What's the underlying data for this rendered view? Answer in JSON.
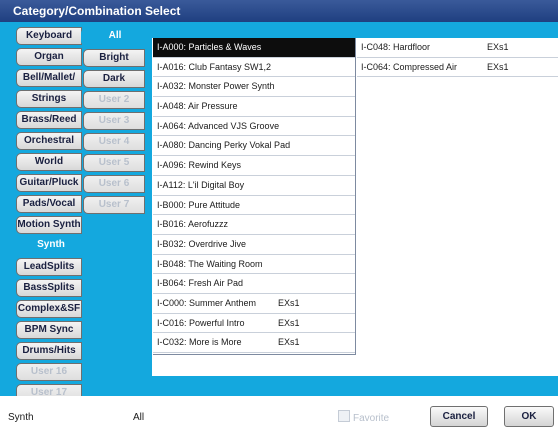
{
  "dialog": {
    "title": "Category/Combination Select"
  },
  "categories": [
    {
      "label": "Keyboard",
      "state": "normal"
    },
    {
      "label": "Organ",
      "state": "normal"
    },
    {
      "label": "Bell/Mallet/",
      "state": "normal"
    },
    {
      "label": "Strings",
      "state": "normal"
    },
    {
      "label": "Brass/Reed",
      "state": "normal"
    },
    {
      "label": "Orchestral",
      "state": "normal"
    },
    {
      "label": "World",
      "state": "normal"
    },
    {
      "label": "Guitar/Pluck",
      "state": "normal"
    },
    {
      "label": "Pads/Vocal",
      "state": "normal"
    },
    {
      "label": "Motion Synth",
      "state": "normal"
    },
    {
      "label": "Synth",
      "state": "selected"
    },
    {
      "label": "LeadSplits",
      "state": "normal"
    },
    {
      "label": "BassSplits",
      "state": "normal"
    },
    {
      "label": "Complex&SF",
      "state": "normal"
    },
    {
      "label": "BPM Sync",
      "state": "normal"
    },
    {
      "label": "Drums/Hits",
      "state": "normal"
    },
    {
      "label": "User 16",
      "state": "disabled"
    },
    {
      "label": "User 17",
      "state": "disabled"
    }
  ],
  "subcategories": [
    {
      "label": "All",
      "state": "selected"
    },
    {
      "label": "Bright",
      "state": "normal"
    },
    {
      "label": "Dark",
      "state": "normal"
    },
    {
      "label": "User 2",
      "state": "disabled"
    },
    {
      "label": "User 3",
      "state": "disabled"
    },
    {
      "label": "User 4",
      "state": "disabled"
    },
    {
      "label": "User 5",
      "state": "disabled"
    },
    {
      "label": "User 6",
      "state": "disabled"
    },
    {
      "label": "User 7",
      "state": "disabled"
    }
  ],
  "list_col1": [
    {
      "name": "I-A000: Particles & Waves",
      "ex": "",
      "selected": true
    },
    {
      "name": "I-A016: Club Fantasy SW1,2",
      "ex": ""
    },
    {
      "name": "I-A032: Monster Power Synth",
      "ex": ""
    },
    {
      "name": "I-A048: Air Pressure",
      "ex": ""
    },
    {
      "name": "I-A064: Advanced VJS Groove",
      "ex": ""
    },
    {
      "name": "I-A080: Dancing Perky Vokal Pad",
      "ex": ""
    },
    {
      "name": "I-A096: Rewind Keys",
      "ex": ""
    },
    {
      "name": "I-A112: L'il Digital Boy",
      "ex": ""
    },
    {
      "name": "I-B000: Pure Attitude",
      "ex": ""
    },
    {
      "name": "I-B016: Aerofuzzz",
      "ex": ""
    },
    {
      "name": "I-B032: Overdrive Jive",
      "ex": ""
    },
    {
      "name": "I-B048: The Waiting Room",
      "ex": ""
    },
    {
      "name": "I-B064: Fresh Air Pad",
      "ex": ""
    },
    {
      "name": "I-C000: Summer Anthem",
      "ex": "EXs1"
    },
    {
      "name": "I-C016: Powerful Intro",
      "ex": "EXs1"
    },
    {
      "name": "I-C032: More is More",
      "ex": "EXs1"
    }
  ],
  "list_col2": [
    {
      "name": "I-C048: Hardfloor",
      "ex": "EXs1"
    },
    {
      "name": "I-C064: Compressed Air",
      "ex": "EXs1"
    }
  ],
  "footer": {
    "category_value": "Synth",
    "subcategory_value": "All",
    "favorite_label": "Favorite",
    "favorite_checked": false,
    "cancel_label": "Cancel",
    "ok_label": "OK"
  },
  "colors": {
    "panel": "#14a8de",
    "title_bar": "#2a4a8c",
    "selected_row": "#0d0d0d"
  }
}
